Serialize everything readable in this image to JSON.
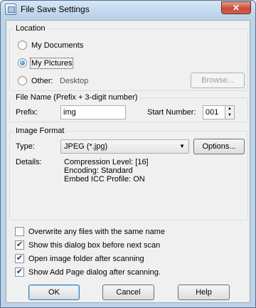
{
  "window": {
    "title": "File Save Settings",
    "close_glyph": "✕"
  },
  "location": {
    "group_title": "Location",
    "options": [
      {
        "label": "My Documents",
        "checked": false
      },
      {
        "label": "My Pictures",
        "checked": true
      },
      {
        "label": "Other:",
        "checked": false
      }
    ],
    "other_path": "Desktop",
    "browse_label": "Browse..."
  },
  "file_name": {
    "group_title": "File Name (Prefix + 3-digit number)",
    "prefix_label": "Prefix:",
    "prefix_value": "img",
    "start_number_label": "Start Number:",
    "start_number_value": "001"
  },
  "image_format": {
    "group_title": "Image Format",
    "type_label": "Type:",
    "type_value": "JPEG (*.jpg)",
    "options_label": "Options...",
    "details_label": "Details:",
    "details": [
      "Compression Level: [16]",
      "Encoding: Standard",
      "Embed ICC Profile: ON"
    ]
  },
  "checkboxes": [
    {
      "label": "Overwrite any files with the same name",
      "checked": false
    },
    {
      "label": "Show this dialog box before next scan",
      "checked": true
    },
    {
      "label": "Open image folder after scanning",
      "checked": true
    },
    {
      "label": "Show Add Page dialog after scanning.",
      "checked": true
    }
  ],
  "buttons": {
    "ok": "OK",
    "cancel": "Cancel",
    "help": "Help"
  },
  "colors": {
    "accent": "#1a73c9",
    "window_frame": "#bcd3ea",
    "client": "#f0f0f0"
  }
}
